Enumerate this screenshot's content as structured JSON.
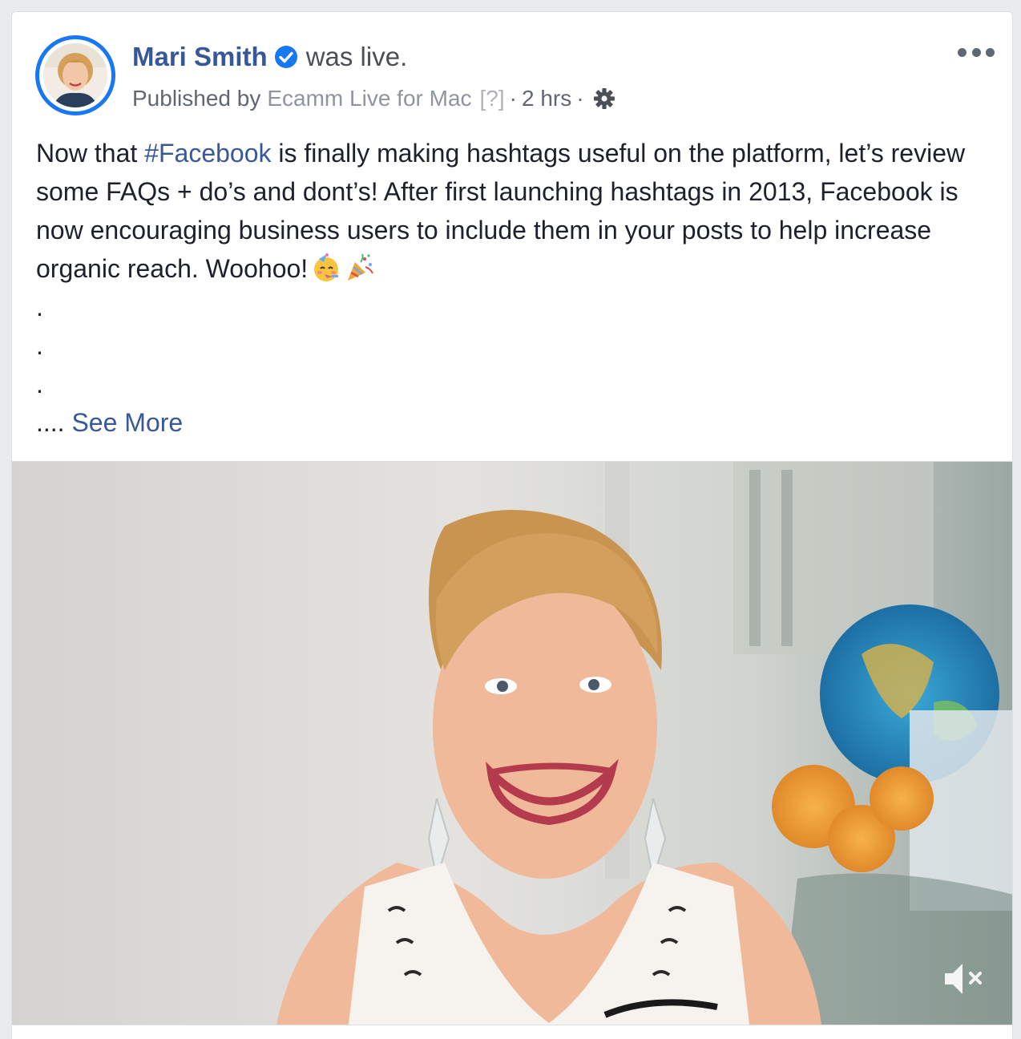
{
  "post": {
    "author": "Mari Smith",
    "action": "was live.",
    "published_prefix": "Published by",
    "app_name": "Ecamm Live for Mac",
    "help_marker": "[?]",
    "separator": "·",
    "time": "2 hrs",
    "text": {
      "part1": "Now that ",
      "hashtag": "#Facebook",
      "part2": " is finally making hashtags useful on the platform, let’s review some FAQs + do’s and dont’s! After first launching hashtags in 2013, Facebook is now encouraging business users to include them in your posts to help increase organic reach. Woohoo!",
      "dot1": ".",
      "dot2": ".",
      "dot3": ".",
      "ellipsis": "....",
      "see_more": "See More"
    },
    "emojis": [
      "partying-face-icon",
      "party-popper-icon"
    ]
  },
  "icons": {
    "verified": "verified-badge-icon",
    "privacy": "gear-icon",
    "more": "more-options-icon",
    "mute": "speaker-muted-icon"
  },
  "colors": {
    "link": "#385898",
    "author": "#365899",
    "verified": "#1877f2",
    "avatar_ring": "#1877f2"
  }
}
